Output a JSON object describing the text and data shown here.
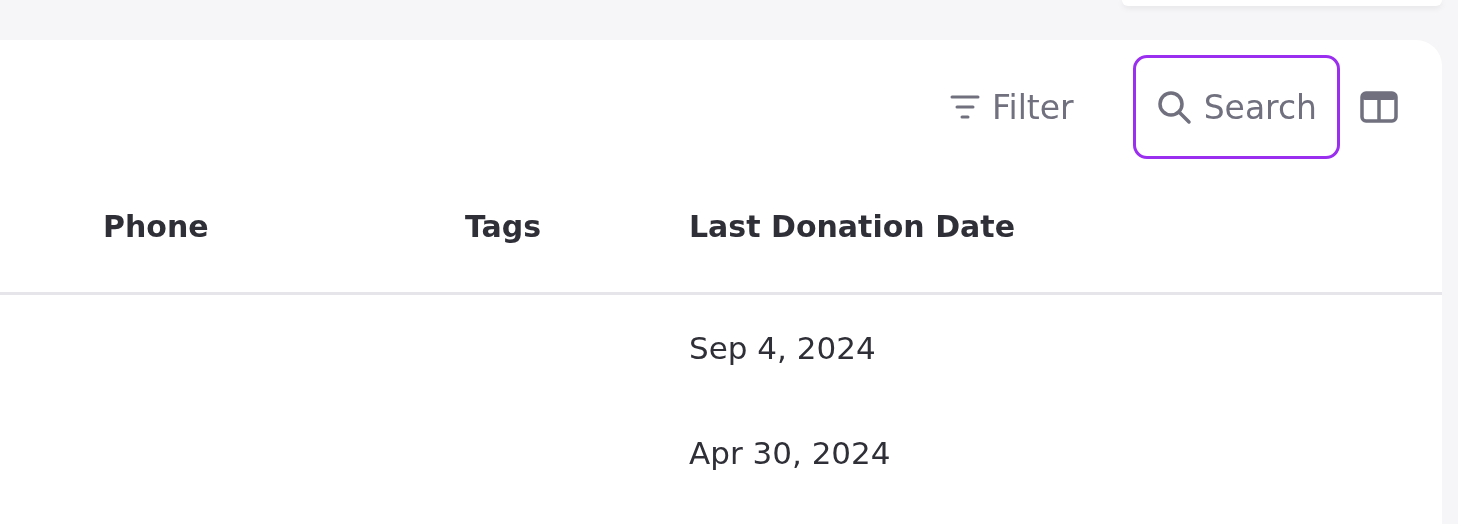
{
  "toolbar": {
    "filter": {
      "label": "Filter"
    },
    "search": {
      "label": "Search",
      "focused": true
    }
  },
  "table": {
    "columns": [
      "Phone",
      "Tags",
      "Last Donation Date"
    ],
    "rows": [
      {
        "cells": [
          "",
          "",
          "Sep 4, 2024"
        ]
      },
      {
        "cells": [
          "",
          "",
          "Apr 30, 2024"
        ]
      }
    ]
  }
}
